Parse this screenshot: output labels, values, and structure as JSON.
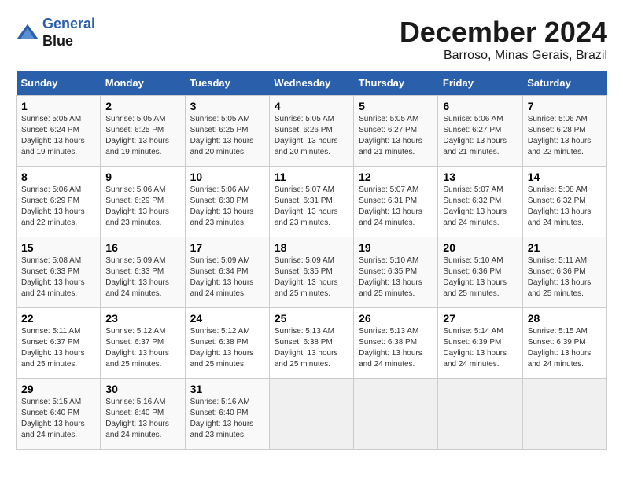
{
  "header": {
    "logo_line1": "General",
    "logo_line2": "Blue",
    "month_title": "December 2024",
    "location": "Barroso, Minas Gerais, Brazil"
  },
  "weekdays": [
    "Sunday",
    "Monday",
    "Tuesday",
    "Wednesday",
    "Thursday",
    "Friday",
    "Saturday"
  ],
  "weeks": [
    [
      {
        "day": "1",
        "rise": "5:05 AM",
        "set": "6:24 PM",
        "daylight": "13 hours and 19 minutes."
      },
      {
        "day": "2",
        "rise": "5:05 AM",
        "set": "6:25 PM",
        "daylight": "13 hours and 19 minutes."
      },
      {
        "day": "3",
        "rise": "5:05 AM",
        "set": "6:25 PM",
        "daylight": "13 hours and 20 minutes."
      },
      {
        "day": "4",
        "rise": "5:05 AM",
        "set": "6:26 PM",
        "daylight": "13 hours and 20 minutes."
      },
      {
        "day": "5",
        "rise": "5:05 AM",
        "set": "6:27 PM",
        "daylight": "13 hours and 21 minutes."
      },
      {
        "day": "6",
        "rise": "5:06 AM",
        "set": "6:27 PM",
        "daylight": "13 hours and 21 minutes."
      },
      {
        "day": "7",
        "rise": "5:06 AM",
        "set": "6:28 PM",
        "daylight": "13 hours and 22 minutes."
      }
    ],
    [
      {
        "day": "8",
        "rise": "5:06 AM",
        "set": "6:29 PM",
        "daylight": "13 hours and 22 minutes."
      },
      {
        "day": "9",
        "rise": "5:06 AM",
        "set": "6:29 PM",
        "daylight": "13 hours and 23 minutes."
      },
      {
        "day": "10",
        "rise": "5:06 AM",
        "set": "6:30 PM",
        "daylight": "13 hours and 23 minutes."
      },
      {
        "day": "11",
        "rise": "5:07 AM",
        "set": "6:31 PM",
        "daylight": "13 hours and 23 minutes."
      },
      {
        "day": "12",
        "rise": "5:07 AM",
        "set": "6:31 PM",
        "daylight": "13 hours and 24 minutes."
      },
      {
        "day": "13",
        "rise": "5:07 AM",
        "set": "6:32 PM",
        "daylight": "13 hours and 24 minutes."
      },
      {
        "day": "14",
        "rise": "5:08 AM",
        "set": "6:32 PM",
        "daylight": "13 hours and 24 minutes."
      }
    ],
    [
      {
        "day": "15",
        "rise": "5:08 AM",
        "set": "6:33 PM",
        "daylight": "13 hours and 24 minutes."
      },
      {
        "day": "16",
        "rise": "5:09 AM",
        "set": "6:33 PM",
        "daylight": "13 hours and 24 minutes."
      },
      {
        "day": "17",
        "rise": "5:09 AM",
        "set": "6:34 PM",
        "daylight": "13 hours and 24 minutes."
      },
      {
        "day": "18",
        "rise": "5:09 AM",
        "set": "6:35 PM",
        "daylight": "13 hours and 25 minutes."
      },
      {
        "day": "19",
        "rise": "5:10 AM",
        "set": "6:35 PM",
        "daylight": "13 hours and 25 minutes."
      },
      {
        "day": "20",
        "rise": "5:10 AM",
        "set": "6:36 PM",
        "daylight": "13 hours and 25 minutes."
      },
      {
        "day": "21",
        "rise": "5:11 AM",
        "set": "6:36 PM",
        "daylight": "13 hours and 25 minutes."
      }
    ],
    [
      {
        "day": "22",
        "rise": "5:11 AM",
        "set": "6:37 PM",
        "daylight": "13 hours and 25 minutes."
      },
      {
        "day": "23",
        "rise": "5:12 AM",
        "set": "6:37 PM",
        "daylight": "13 hours and 25 minutes."
      },
      {
        "day": "24",
        "rise": "5:12 AM",
        "set": "6:38 PM",
        "daylight": "13 hours and 25 minutes."
      },
      {
        "day": "25",
        "rise": "5:13 AM",
        "set": "6:38 PM",
        "daylight": "13 hours and 25 minutes."
      },
      {
        "day": "26",
        "rise": "5:13 AM",
        "set": "6:38 PM",
        "daylight": "13 hours and 24 minutes."
      },
      {
        "day": "27",
        "rise": "5:14 AM",
        "set": "6:39 PM",
        "daylight": "13 hours and 24 minutes."
      },
      {
        "day": "28",
        "rise": "5:15 AM",
        "set": "6:39 PM",
        "daylight": "13 hours and 24 minutes."
      }
    ],
    [
      {
        "day": "29",
        "rise": "5:15 AM",
        "set": "6:40 PM",
        "daylight": "13 hours and 24 minutes."
      },
      {
        "day": "30",
        "rise": "5:16 AM",
        "set": "6:40 PM",
        "daylight": "13 hours and 24 minutes."
      },
      {
        "day": "31",
        "rise": "5:16 AM",
        "set": "6:40 PM",
        "daylight": "13 hours and 23 minutes."
      },
      null,
      null,
      null,
      null
    ]
  ]
}
